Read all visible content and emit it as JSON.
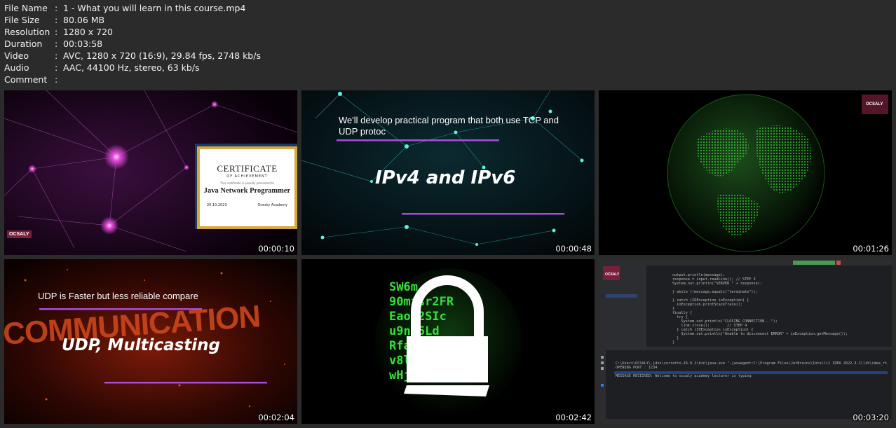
{
  "metadata": [
    {
      "key": "File Name",
      "value": "1 - What you will learn in this course.mp4"
    },
    {
      "key": "File Size",
      "value": "80.06 MB"
    },
    {
      "key": "Resolution",
      "value": "1280 x 720"
    },
    {
      "key": "Duration",
      "value": "00:03:58"
    },
    {
      "key": "Video",
      "value": "AVC, 1280 x 720 (16:9), 29.84 fps, 2748 kb/s"
    },
    {
      "key": "Audio",
      "value": "AAC, 44100 Hz, stereo, 63 kb/s"
    },
    {
      "key": "Comment",
      "value": ""
    }
  ],
  "separator": ":",
  "thumbnails": [
    {
      "timestamp": "00:00:10",
      "certificate": {
        "title": "CERTIFICATE",
        "subtitle": "OF ACHIEVEMENT",
        "presented": "This certificate is proudly presented to",
        "name": "Java Network Programmer",
        "date": "20.10.2023",
        "org": "Oceaty Academy"
      },
      "watermark": "OCSALY"
    },
    {
      "timestamp": "00:00:48",
      "caption": "We'll develop practical program that both use TCP and UDP protoc",
      "headline": "IPv4 and IPv6"
    },
    {
      "timestamp": "00:01:26",
      "watermark": "OCSALY"
    },
    {
      "timestamp": "00:02:04",
      "caption": "UDP is Faster but less reliable compare",
      "background_word": "COMMUNICATION",
      "headline": "UDP, Multicasting"
    },
    {
      "timestamp": "00:02:42",
      "matrix_text": "SW6m\n90mfsr2FR\nEaoA2SIc\nu9nt5Ld\nRfa9lck\nv8lMdsLp\nwHjt3o0"
    },
    {
      "timestamp": "00:03:20",
      "ide_code": "output.println(message);\nresponse = input.readLine(); // STEP 3\nSystem.out.println(\"SERVER \" + response);\n\n} while (!message.equals(\"terminate\"));\n\n} catch (IOException ioException) {\n  ioException.printStackTrace();\n}\nfinally {\n  try {\n    System.out.println(\"CLOSING CONNECTION...\");\n    link.close();        // STEP 4\n  } catch (IOException ioException) {\n    System.out.println(\"Unable to disconnect ERROR\" + ioException.getMessage());\n  }\n}",
      "console_text": "C:\\Users\\OCSALY\\.jdks\\corretto-16.0.2\\bin\\java.exe \"-javaagent:C:\\Program Files\\JetBrains\\IntelliJ IDEA 2022.3.2\\lib\\idea_rt.jar=50171:C:\\Program Files\nOPENING PORT : 1234\n\nMESSAGE RECEIVED: Welcome to ocsaly academy lecturer is typing",
      "watermark": "OCSALY"
    }
  ],
  "colors": {
    "background": "#2b2b2b",
    "text": "#f2f2f2",
    "accent_purple": "#a64ddb",
    "matrix_green": "#35e03a"
  }
}
